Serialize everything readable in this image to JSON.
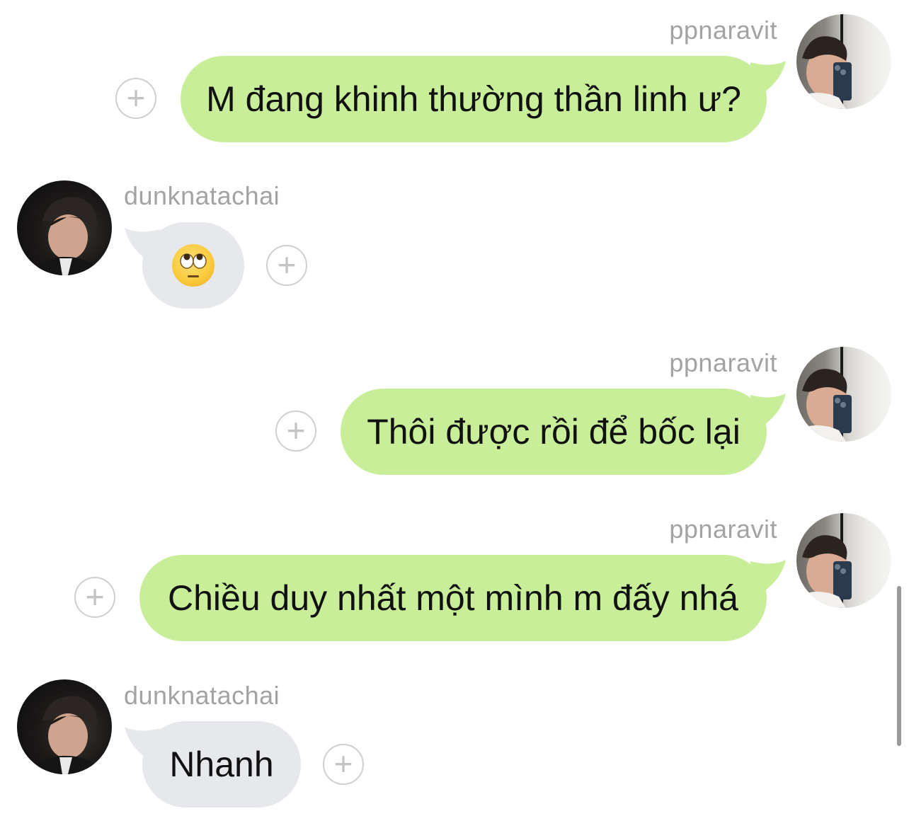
{
  "messages": [
    {
      "sender": "ppnaravit",
      "text": "M đang khinh thường thần linh ư?"
    },
    {
      "sender": "dunknatachai",
      "emoji": "face-with-rolling-eyes"
    },
    {
      "sender": "ppnaravit",
      "text": "Thôi được rồi để bốc lại"
    },
    {
      "sender": "ppnaravit",
      "text": "Chiều duy nhất một mình m đấy nhá"
    },
    {
      "sender": "dunknatachai",
      "text": "Nhanh"
    }
  ],
  "colors": {
    "outgoing_bubble": "#c9ee9a",
    "incoming_bubble": "#e6e8ec",
    "username": "#a3a3a3"
  },
  "icons": {
    "react": "add-reaction-icon",
    "plus_glyph": "+"
  }
}
